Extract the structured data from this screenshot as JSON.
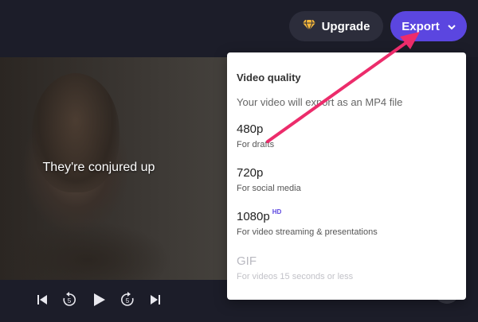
{
  "header": {
    "upgrade_label": "Upgrade",
    "export_label": "Export"
  },
  "player": {
    "caption": "They're conjured up"
  },
  "export_menu": {
    "title": "Video quality",
    "subtitle": "Your video will export as an MP4 file",
    "options": [
      {
        "label": "480p",
        "description": "For drafts",
        "badge": "",
        "disabled": false
      },
      {
        "label": "720p",
        "description": "For social media",
        "badge": "",
        "disabled": false
      },
      {
        "label": "1080p",
        "description": "For video streaming & presentations",
        "badge": "HD",
        "disabled": false
      },
      {
        "label": "GIF",
        "description": "For videos 15 seconds or less",
        "badge": "",
        "disabled": true
      }
    ]
  },
  "colors": {
    "accent": "#5b46e0",
    "annotation_arrow": "#ec2c6b",
    "upgrade_icon": "#f5b73a"
  },
  "icons": [
    "diamond-icon",
    "chevron-down-icon",
    "skip-back-icon",
    "rewind-5-icon",
    "play-icon",
    "forward-5-icon",
    "skip-forward-icon"
  ]
}
